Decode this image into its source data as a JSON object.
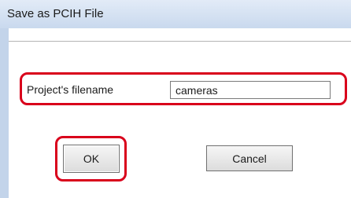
{
  "window": {
    "title": "Save as PCIH File"
  },
  "form": {
    "filename_label": "Project's filename",
    "filename_value": "cameras"
  },
  "buttons": {
    "ok_label": "OK",
    "cancel_label": "Cancel"
  },
  "annotation_color": "#d9001b"
}
